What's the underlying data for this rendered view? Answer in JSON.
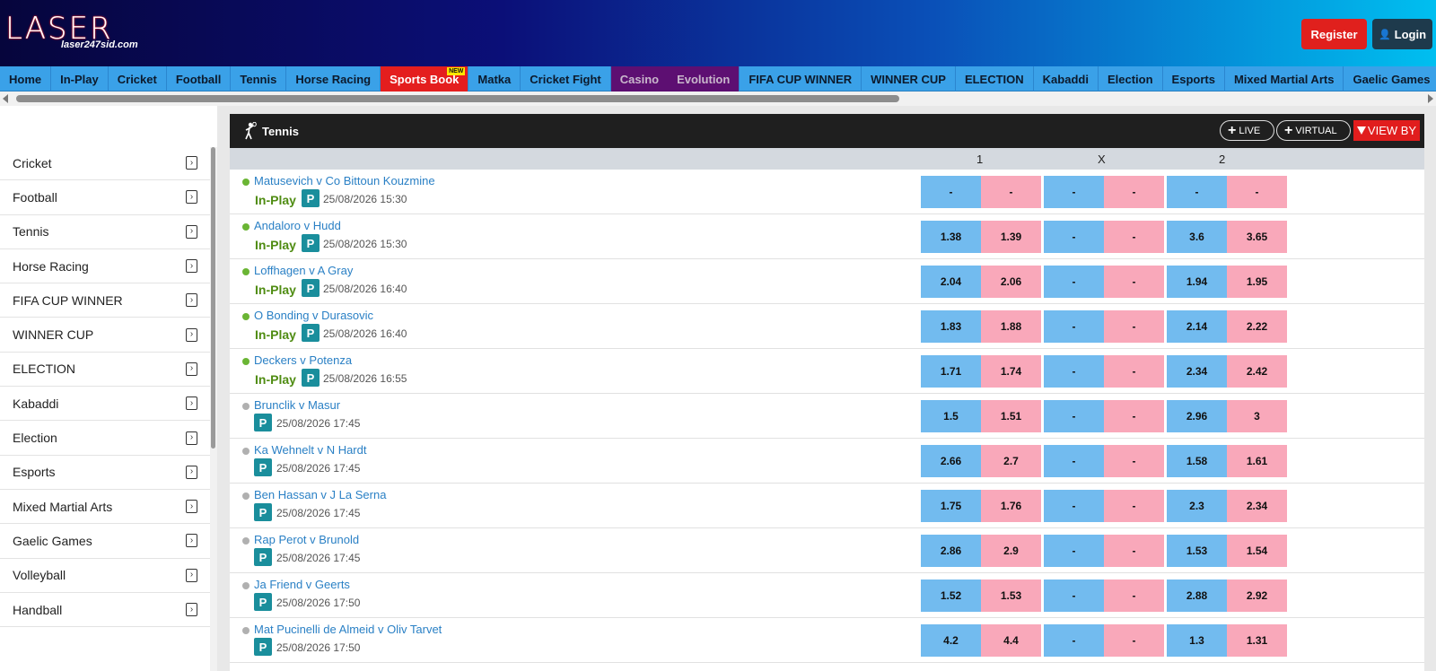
{
  "header": {
    "logo_text": "LASER",
    "logo_sub": "laser247sid.com",
    "register_label": "Register",
    "login_label": "Login"
  },
  "nav": {
    "items": [
      "Home",
      "In-Play",
      "Cricket",
      "Football",
      "Tennis",
      "Horse Racing",
      "Sports Book",
      "Matka",
      "Cricket Fight",
      "Casino",
      "Evolution",
      "FIFA CUP WINNER",
      "WINNER CUP",
      "ELECTION",
      "Kabaddi",
      "Election",
      "Esports",
      "Mixed Martial Arts",
      "Gaelic Games"
    ],
    "new_badge": "NEW"
  },
  "sidebar": {
    "items": [
      "Cricket",
      "Football",
      "Tennis",
      "Horse Racing",
      "FIFA CUP WINNER",
      "WINNER CUP",
      "ELECTION",
      "Kabaddi",
      "Election",
      "Esports",
      "Mixed Martial Arts",
      "Gaelic Games",
      "Volleyball",
      "Handball"
    ]
  },
  "panel": {
    "title": "Tennis",
    "live_label": "LIVE",
    "virtual_label": "VIRTUAL",
    "viewby_label": "VIEW BY",
    "col_1": "1",
    "col_x": "X",
    "col_2": "2",
    "inplay_label": "In-Play",
    "p_label": "P"
  },
  "matches": [
    {
      "name": "Matusevich v Co Bittoun Kouzmine",
      "live": true,
      "time": "25/08/2026 15:30",
      "odds": [
        "-",
        "-",
        "-",
        "-",
        "-",
        "-"
      ]
    },
    {
      "name": "Andaloro v Hudd",
      "live": true,
      "time": "25/08/2026 15:30",
      "odds": [
        "1.38",
        "1.39",
        "-",
        "-",
        "3.6",
        "3.65"
      ]
    },
    {
      "name": "Loffhagen v A Gray",
      "live": true,
      "time": "25/08/2026 16:40",
      "odds": [
        "2.04",
        "2.06",
        "-",
        "-",
        "1.94",
        "1.95"
      ]
    },
    {
      "name": "O Bonding v Durasovic",
      "live": true,
      "time": "25/08/2026 16:40",
      "odds": [
        "1.83",
        "1.88",
        "-",
        "-",
        "2.14",
        "2.22"
      ]
    },
    {
      "name": "Deckers v Potenza",
      "live": true,
      "time": "25/08/2026 16:55",
      "odds": [
        "1.71",
        "1.74",
        "-",
        "-",
        "2.34",
        "2.42"
      ]
    },
    {
      "name": "Brunclik v Masur",
      "live": false,
      "time": "25/08/2026 17:45",
      "odds": [
        "1.5",
        "1.51",
        "-",
        "-",
        "2.96",
        "3"
      ]
    },
    {
      "name": "Ka Wehnelt v N Hardt",
      "live": false,
      "time": "25/08/2026 17:45",
      "odds": [
        "2.66",
        "2.7",
        "-",
        "-",
        "1.58",
        "1.61"
      ]
    },
    {
      "name": "Ben Hassan v J La Serna",
      "live": false,
      "time": "25/08/2026 17:45",
      "odds": [
        "1.75",
        "1.76",
        "-",
        "-",
        "2.3",
        "2.34"
      ]
    },
    {
      "name": "Rap Perot v Brunold",
      "live": false,
      "time": "25/08/2026 17:45",
      "odds": [
        "2.86",
        "2.9",
        "-",
        "-",
        "1.53",
        "1.54"
      ]
    },
    {
      "name": "Ja Friend v Geerts",
      "live": false,
      "time": "25/08/2026 17:50",
      "odds": [
        "1.52",
        "1.53",
        "-",
        "-",
        "2.88",
        "2.92"
      ]
    },
    {
      "name": "Mat Pucinelli de Almeid v Oliv Tarvet",
      "live": false,
      "time": "25/08/2026 17:50",
      "odds": [
        "4.2",
        "4.4",
        "-",
        "-",
        "1.3",
        "1.31"
      ]
    }
  ],
  "colors": {
    "back": "#72bbef",
    "lay": "#f9a8ba",
    "nav_bg": "#3aa1e8",
    "live_green": "#4f8c12",
    "accent_red": "#e11d1d"
  }
}
